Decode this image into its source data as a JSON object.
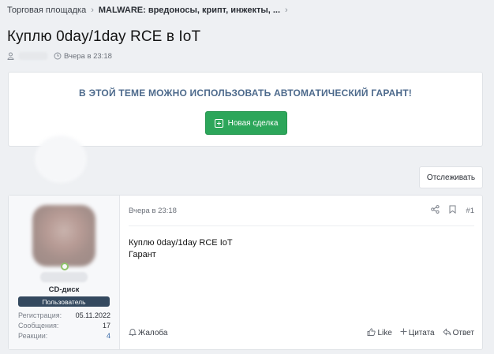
{
  "breadcrumb": {
    "items": [
      "Торговая площадка",
      "MALWARE: вредоносы, крипт, инжекты, ..."
    ],
    "separator": "›"
  },
  "thread": {
    "title": "Куплю 0day/1day RCE в IoT",
    "date": "Вчера в 23:18"
  },
  "notice": {
    "text": "В ЭТОЙ ТЕМЕ МОЖНО ИСПОЛЬЗОВАТЬ АВТОМАТИЧЕСКИЙ ГАРАНТ!",
    "button_label": "Новая сделка",
    "button_color": "#2ca65a"
  },
  "watch_label": "Отслеживать",
  "post": {
    "user_title": "CD-диск",
    "role": "Пользователь",
    "stats": [
      {
        "label": "Регистрация:",
        "value": "05.11.2022"
      },
      {
        "label": "Сообщения:",
        "value": "17"
      },
      {
        "label": "Реакции:",
        "value": "4"
      }
    ],
    "date": "Вчера в 23:18",
    "number": "#1",
    "body_lines": [
      "Куплю 0day/1day RCE IoT",
      "Гарант"
    ],
    "report_label": "Жалоба",
    "like_label": "Like",
    "quote_label": "Цитата",
    "reply_label": "Ответ"
  },
  "icons": {
    "user": "user-icon",
    "clock": "clock-icon",
    "share": "share-icon",
    "bookmark": "bookmark-icon",
    "report": "bell-icon",
    "like": "thumbs-up-icon",
    "quote": "plus-icon",
    "reply": "reply-icon"
  }
}
